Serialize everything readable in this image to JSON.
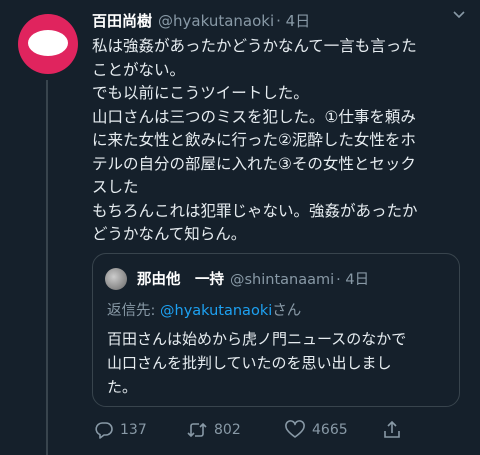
{
  "tweet": {
    "author_name": "百田尚樹",
    "author_handle": "@hyakutanaoki",
    "time": "· 4日",
    "lines": [
      "私は強姦があったかどうかなんて一言も言った",
      "ことがない。",
      "でも以前にこうツイートした。",
      "山口さんは三つのミスを犯した。①仕事を頼み",
      "に来た女性と飲みに行った②泥酔した女性をホ",
      "テルの自分の部屋に入れた③その女性とセック",
      "スした",
      "もちろんこれは犯罪じゃない。強姦があったか",
      "どうかなんて知らん。"
    ]
  },
  "quote": {
    "author_name": "那由他　一持",
    "author_handle": "@shintanaami",
    "time": "· 4日",
    "reply_prefix": "返信先: ",
    "reply_mention": "@hyakutanaoki",
    "reply_suffix": "さん",
    "lines": [
      "百田さんは始めから虎ノ門ニュースのなかで",
      "山口さんを批判していたのを思い出しまし",
      "た。"
    ]
  },
  "actions": {
    "replies": "137",
    "retweets": "802",
    "likes": "4665"
  },
  "icons": {
    "more": "chevron-down-icon",
    "reply": "reply-icon",
    "retweet": "retweet-icon",
    "like": "heart-icon",
    "share": "share-icon"
  },
  "colors": {
    "background": "#15202b",
    "avatar": "#e0245e",
    "muted": "#8899a6",
    "link": "#1da1f2"
  }
}
